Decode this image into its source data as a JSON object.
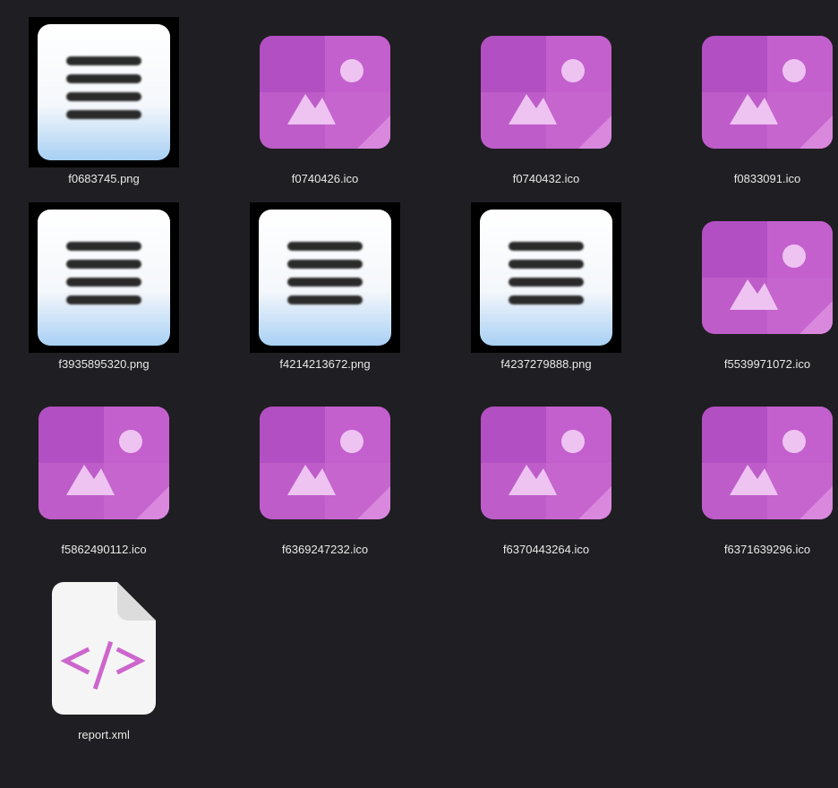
{
  "files": [
    {
      "name": "f0683745.png",
      "kind": "doc-thumb",
      "icon": "text-document-icon"
    },
    {
      "name": "f0740426.ico",
      "kind": "image",
      "icon": "image-file-icon"
    },
    {
      "name": "f0740432.ico",
      "kind": "image",
      "icon": "image-file-icon"
    },
    {
      "name": "f0833091.ico",
      "kind": "image",
      "icon": "image-file-icon"
    },
    {
      "name": "f3935895320.png",
      "kind": "doc-thumb",
      "icon": "text-document-icon"
    },
    {
      "name": "f4214213672.png",
      "kind": "doc-thumb",
      "icon": "text-document-icon"
    },
    {
      "name": "f4237279888.png",
      "kind": "doc-thumb",
      "icon": "text-document-icon"
    },
    {
      "name": "f5539971072.ico",
      "kind": "image",
      "icon": "image-file-icon"
    },
    {
      "name": "f5862490112.ico",
      "kind": "image",
      "icon": "image-file-icon"
    },
    {
      "name": "f6369247232.ico",
      "kind": "image",
      "icon": "image-file-icon"
    },
    {
      "name": "f6370443264.ico",
      "kind": "image",
      "icon": "image-file-icon"
    },
    {
      "name": "f6371639296.ico",
      "kind": "image",
      "icon": "image-file-icon"
    },
    {
      "name": "report.xml",
      "kind": "xml",
      "icon": "xml-code-file-icon"
    }
  ],
  "colors": {
    "background": "#1f1e22",
    "image_icon_primary": "#b04fc0",
    "image_icon_secondary": "#d070d4",
    "xml_accent": "#cc66cc"
  }
}
